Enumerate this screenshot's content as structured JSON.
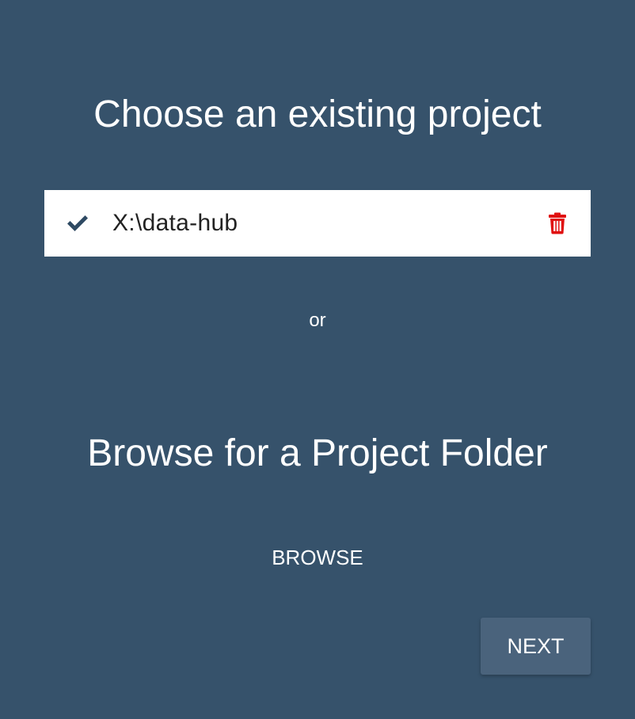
{
  "existing": {
    "title": "Choose an existing project",
    "projects": [
      {
        "path": "X:\\data-hub",
        "selected": true,
        "icons": {
          "selected": "check-icon",
          "delete": "trash-icon"
        }
      }
    ]
  },
  "separator": "or",
  "browse": {
    "title": "Browse for a Project Folder",
    "button_label": "BROWSE"
  },
  "footer": {
    "next_label": "NEXT"
  },
  "colors": {
    "background": "#36526b",
    "row_background": "#ffffff",
    "check": "#2e4a63",
    "trash": "#e01010",
    "next_button": "#4a637c",
    "text": "#ffffff"
  }
}
